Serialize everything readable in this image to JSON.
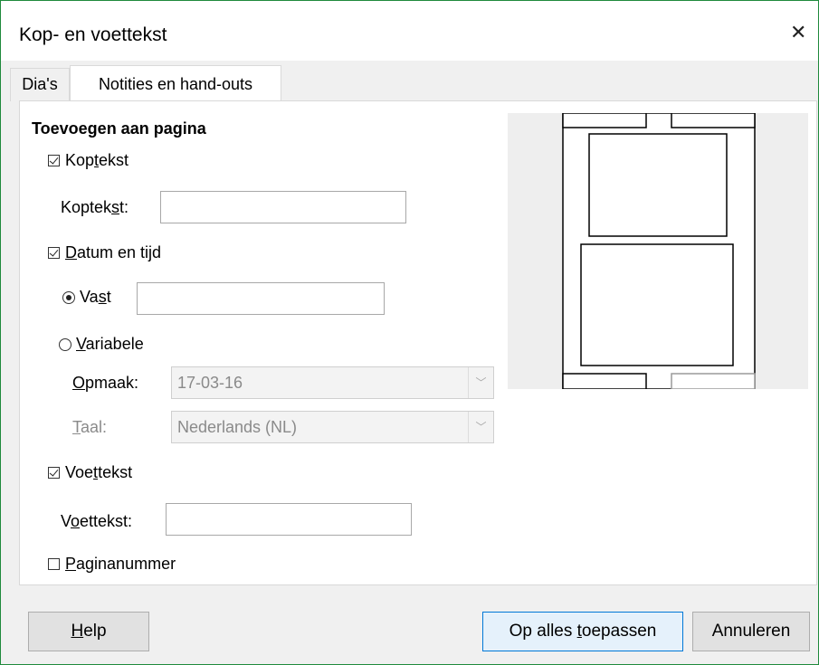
{
  "window": {
    "title": "Kop- en voettekst",
    "close_glyph": "✕"
  },
  "tabs": [
    {
      "label": "Dia's",
      "active": false
    },
    {
      "label": "Notities en hand-outs",
      "active": true
    }
  ],
  "section_title": "Toevoegen aan pagina",
  "header": {
    "checkbox_label_pre": "Kop",
    "checkbox_label_u": "t",
    "checkbox_label_post": "ekst",
    "checked": true,
    "field_label_pre": "Koptek",
    "field_label_u": "s",
    "field_label_post": "t:",
    "value": ""
  },
  "datetime": {
    "checkbox_label_pre": "",
    "checkbox_label_u": "D",
    "checkbox_label_post": "atum en tijd",
    "checked": true,
    "fixed": {
      "label_pre": "Va",
      "label_u": "s",
      "label_post": "t",
      "selected": true,
      "value": ""
    },
    "variable": {
      "label_pre": "",
      "label_u": "V",
      "label_post": "ariabele",
      "selected": false
    },
    "format": {
      "label_pre": "",
      "label_u": "O",
      "label_post": "pmaak:",
      "value": "17-03-16"
    },
    "language": {
      "label_pre": "",
      "label_u": "T",
      "label_post": "aal:",
      "value": "Nederlands (NL)"
    }
  },
  "footer": {
    "checkbox_label_pre": "Voe",
    "checkbox_label_u": "t",
    "checkbox_label_post": "tekst",
    "checked": true,
    "field_label_pre": "V",
    "field_label_u": "o",
    "field_label_post": "ettekst:",
    "value": ""
  },
  "page_number": {
    "label_pre": "",
    "label_u": "P",
    "label_post": "aginanummer",
    "checked": false
  },
  "buttons": {
    "help_u": "H",
    "help_rest": "elp",
    "apply_pre": "Op alles ",
    "apply_u": "t",
    "apply_post": "oepassen",
    "cancel": "Annuleren"
  },
  "colors": {
    "accent": "#0078d7",
    "window_border": "#1f8a3c"
  }
}
